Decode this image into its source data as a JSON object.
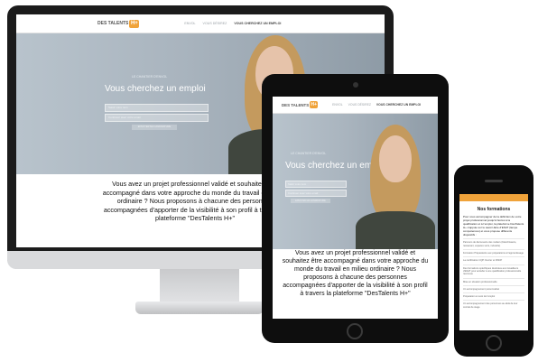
{
  "brand": {
    "logo_text": "DES TALENTS",
    "logo_plus": "H+",
    "accent": "#f0a33a"
  },
  "nav": {
    "items": [
      "ENVOL",
      "VOUS DÉSIREZ",
      "VOUS CHERCHEZ UN EMPLOI"
    ]
  },
  "hero": {
    "kicker": "LE CHANTIER D'ENVOL",
    "title": "Vous cherchez un emploi",
    "field1_placeholder": "Saisir votre nom",
    "field2_placeholder": "Continuer avec votre email",
    "cta_label": "ENVOYER MA CANDIDATURE"
  },
  "intro": {
    "desktop_text": "Vous avez un projet professionnel validé et souhaitez être accompagné dans votre approche du monde du travail en milieu ordinaire ? Nous proposons à chacune des personnes accompagnées d'apporter de la visibilité à son profil à travers la plateforme \"DesTalents H+\"",
    "tablet_text": "Vous avez un projet professionnel validé et souhaitez être accompagné dans votre approche du monde du travail en milieu ordinaire ? Nous proposons à chacune des personnes accompagnées d'apporter de la visibilité à son profil à travers la plateforme \"DesTalents H+\""
  },
  "phone": {
    "section_title": "Nos formations",
    "intro": "Pour vous accompagner de la définition de votre projet professionnel jusqu'à l'accès à la qualification et à l'emploi, la plateforme DesTalents H+ s'appuie sur le savoir-faire d'ESAT (lampe compétences) et vous propose différents dispositifs :",
    "items": [
      "Parcours de découverte des métiers (blanchisserie, restaurant, espaces verts, industrie)",
      "Formation Préparatoire aux préparations à l'apprentissage",
      "La certification CQP Ouvrier et RNCP",
      "Des formations spécifiques destinées aux travailleurs d'ESAT pour accéder à une qualification professionnelle reconnue",
      "Mise en situation professionnelle",
      "Un accompagnement personnalisé",
      "Préparation et suivi de l'emploi",
      "Un accompagnement des personnes au-delà de leur contrat de stage"
    ]
  }
}
